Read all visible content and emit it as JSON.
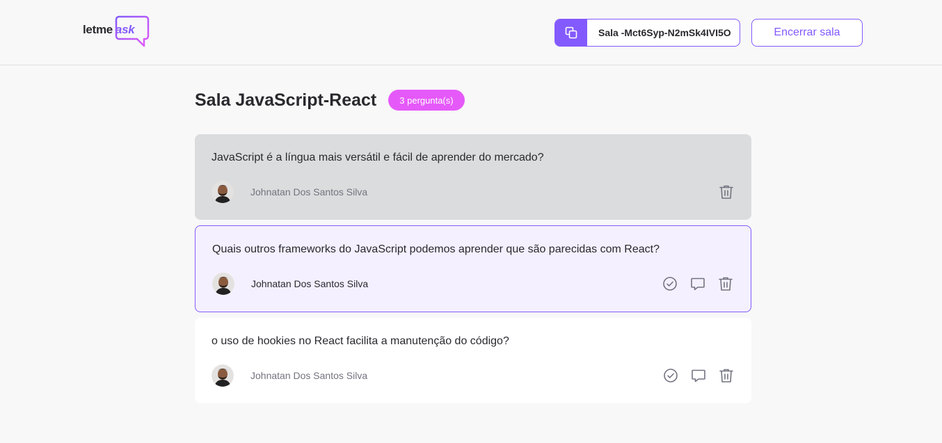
{
  "header": {
    "logo_main": "letme",
    "logo_accent": "ask",
    "room_code": "Sala -Mct6Syp-N2mSk4IVI5O",
    "end_room_label": "Encerrar sala"
  },
  "page": {
    "title": "Sala JavaScript-React",
    "question_count": "3 pergunta(s)"
  },
  "questions": [
    {
      "text": "JavaScript é a língua mais versátil e fácil de aprender do mercado?",
      "author": "Johnatan Dos Santos Silva",
      "state": "answered"
    },
    {
      "text": "Quais outros frameworks do JavaScript podemos aprender que são parecidas com React?",
      "author": "Johnatan Dos Santos Silva",
      "state": "highlighted"
    },
    {
      "text": "o uso de hookies no React facilita a manutenção do código?",
      "author": "Johnatan Dos Santos Silva",
      "state": "normal"
    }
  ],
  "colors": {
    "accent": "#835afd",
    "badge": "#e559f9",
    "answered_bg": "#dbdcdd",
    "highlighted_bg": "#f4f0ff"
  }
}
